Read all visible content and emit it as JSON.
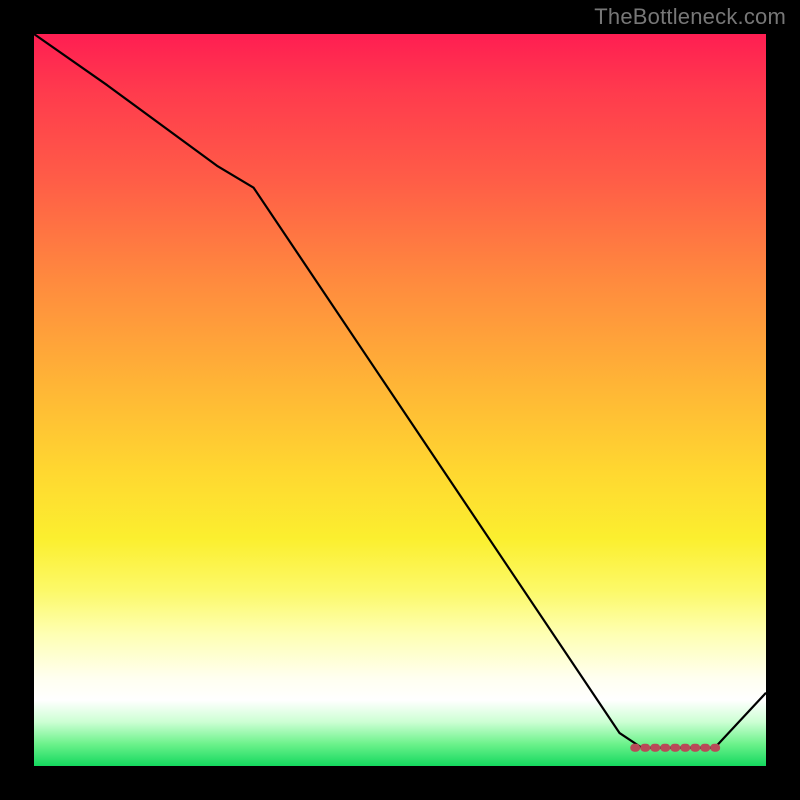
{
  "watermark": "TheBottleneck.com",
  "chart_data": {
    "type": "line",
    "title": "",
    "xlabel": "",
    "ylabel": "",
    "xlim": [
      0,
      100
    ],
    "ylim": [
      0,
      100
    ],
    "series": [
      {
        "name": "curve",
        "x": [
          0,
          10,
          25,
          30,
          80,
          83,
          93,
          100
        ],
        "y": [
          100,
          93,
          82,
          79,
          4.5,
          2.5,
          2.5,
          10
        ]
      }
    ],
    "flat_segment": {
      "name": "flat-highlight",
      "x_start": 82,
      "x_end": 94,
      "y": 2.5
    },
    "colors": {
      "curve": "#000000",
      "flat_highlight": "#b84a58",
      "background_top": "#ff1e52",
      "background_bottom": "#14d85e",
      "frame": "#000000"
    }
  }
}
